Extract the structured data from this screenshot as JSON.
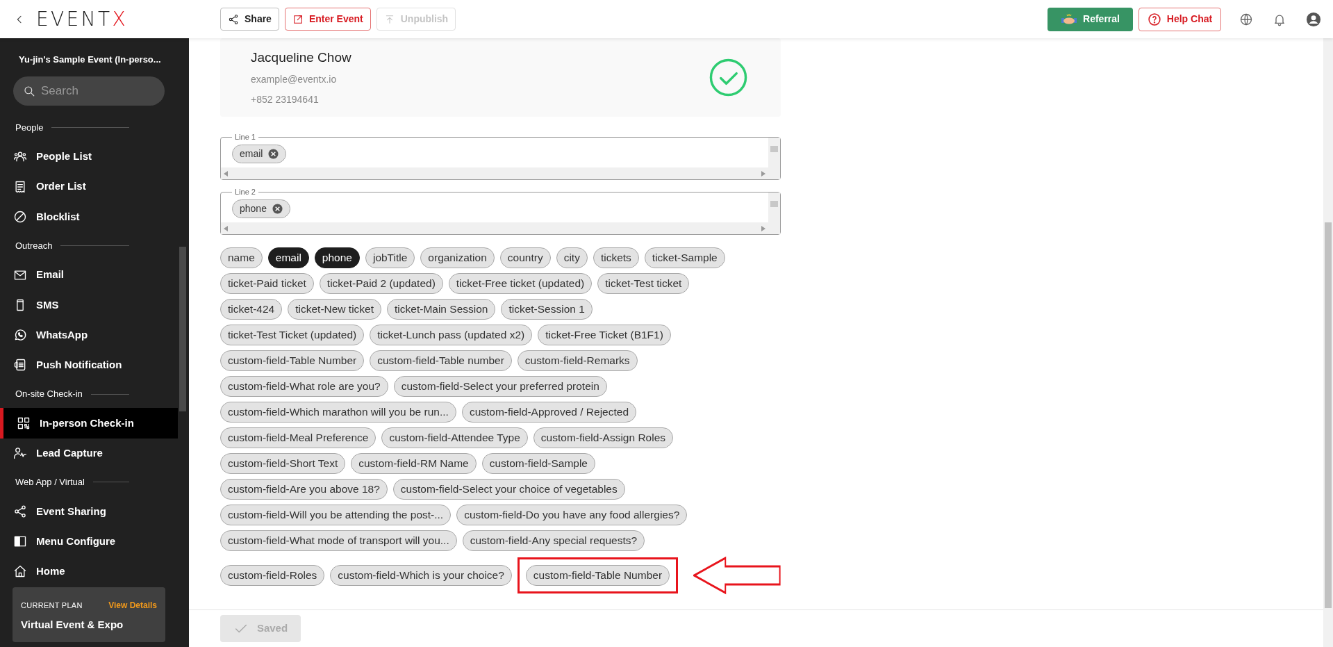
{
  "header": {
    "logo": "EVENTX",
    "actions": [
      {
        "label": "Share",
        "kind": "outline"
      },
      {
        "label": "Enter Event",
        "kind": "danger"
      },
      {
        "label": "Unpublish",
        "kind": "disabled"
      }
    ],
    "referral": "Referral",
    "help": "Help Chat"
  },
  "sidebar": {
    "event_title": "Yu-jin's Sample Event (In-perso...",
    "search": {
      "placeholder": "Search"
    },
    "sections": [
      {
        "title": "People",
        "items": [
          {
            "label": "People List",
            "selected": false
          },
          {
            "label": "Order List",
            "selected": false
          },
          {
            "label": "Blocklist",
            "selected": false
          }
        ]
      },
      {
        "title": "Outreach",
        "items": [
          {
            "label": "Email",
            "selected": false
          },
          {
            "label": "SMS",
            "selected": false
          },
          {
            "label": "WhatsApp",
            "selected": false
          },
          {
            "label": "Push Notification",
            "selected": false
          }
        ]
      },
      {
        "title": "On-site Check-in",
        "items": [
          {
            "label": "In-person Check-in",
            "selected": true
          },
          {
            "label": "Lead Capture",
            "selected": false
          }
        ]
      },
      {
        "title": "Web App / Virtual",
        "items": [
          {
            "label": "Event Sharing",
            "selected": false
          },
          {
            "label": "Menu Configure",
            "selected": false
          },
          {
            "label": "Home",
            "selected": false
          }
        ]
      }
    ],
    "plan": {
      "label": "CURRENT PLAN",
      "link": "View Details",
      "name": "Virtual Event & Expo"
    }
  },
  "preview": {
    "name": "Jacqueline Chow",
    "email": "example@eventx.io",
    "phone": "+852 23194641",
    "verified": true
  },
  "lines": [
    {
      "label": "Line 1",
      "tags": [
        "email"
      ]
    },
    {
      "label": "Line 2",
      "tags": [
        "phone"
      ]
    }
  ],
  "chip_rows": [
    [
      {
        "label": "name",
        "selected": false
      },
      {
        "label": "email",
        "selected": true
      },
      {
        "label": "phone",
        "selected": true
      },
      {
        "label": "jobTitle",
        "selected": false
      },
      {
        "label": "organization",
        "selected": false
      },
      {
        "label": "country",
        "selected": false
      },
      {
        "label": "city",
        "selected": false
      },
      {
        "label": "tickets",
        "selected": false
      },
      {
        "label": "ticket-Sample",
        "selected": false
      }
    ],
    [
      {
        "label": "ticket-Paid ticket",
        "selected": false
      },
      {
        "label": "ticket-Paid 2 (updated)",
        "selected": false
      },
      {
        "label": "ticket-Free ticket (updated)",
        "selected": false
      },
      {
        "label": "ticket-Test ticket",
        "selected": false
      }
    ],
    [
      {
        "label": "ticket-424",
        "selected": false
      },
      {
        "label": "ticket-New ticket",
        "selected": false
      },
      {
        "label": "ticket-Main Session",
        "selected": false
      },
      {
        "label": "ticket-Session 1",
        "selected": false
      }
    ],
    [
      {
        "label": "ticket-Test Ticket (updated)",
        "selected": false
      },
      {
        "label": "ticket-Lunch pass (updated x2)",
        "selected": false
      },
      {
        "label": "ticket-Free Ticket (B1F1)",
        "selected": false
      }
    ],
    [
      {
        "label": "custom-field-Table Number",
        "selected": false
      },
      {
        "label": "custom-field-Table number",
        "selected": false
      },
      {
        "label": "custom-field-Remarks",
        "selected": false
      }
    ],
    [
      {
        "label": "custom-field-What role are you?",
        "selected": false
      },
      {
        "label": "custom-field-Select your preferred protein",
        "selected": false
      }
    ],
    [
      {
        "label": "custom-field-Which marathon will you be run...",
        "selected": false
      },
      {
        "label": "custom-field-Approved / Rejected",
        "selected": false
      }
    ],
    [
      {
        "label": "custom-field-Meal Preference",
        "selected": false
      },
      {
        "label": "custom-field-Attendee Type",
        "selected": false
      },
      {
        "label": "custom-field-Assign Roles",
        "selected": false
      }
    ],
    [
      {
        "label": "custom-field-Short Text",
        "selected": false
      },
      {
        "label": "custom-field-RM Name",
        "selected": false
      },
      {
        "label": "custom-field-Sample",
        "selected": false
      }
    ],
    [
      {
        "label": "custom-field-Are you above 18?",
        "selected": false
      },
      {
        "label": "custom-field-Select your choice of vegetables",
        "selected": false
      }
    ],
    [
      {
        "label": "custom-field-Will you be attending the post-...",
        "selected": false
      },
      {
        "label": "custom-field-Do you have any food allergies?",
        "selected": false
      }
    ],
    [
      {
        "label": "custom-field-What mode of transport will you...",
        "selected": false
      },
      {
        "label": "custom-field-Any special requests?",
        "selected": false
      }
    ],
    [
      {
        "label": "custom-field-Roles",
        "selected": false
      },
      {
        "label": "custom-field-Which is your choice?",
        "selected": false
      },
      {
        "label": "custom-field-Table Number",
        "selected": false,
        "highlighted": true
      }
    ]
  ],
  "save_button": {
    "label": "Saved",
    "disabled": true
  }
}
